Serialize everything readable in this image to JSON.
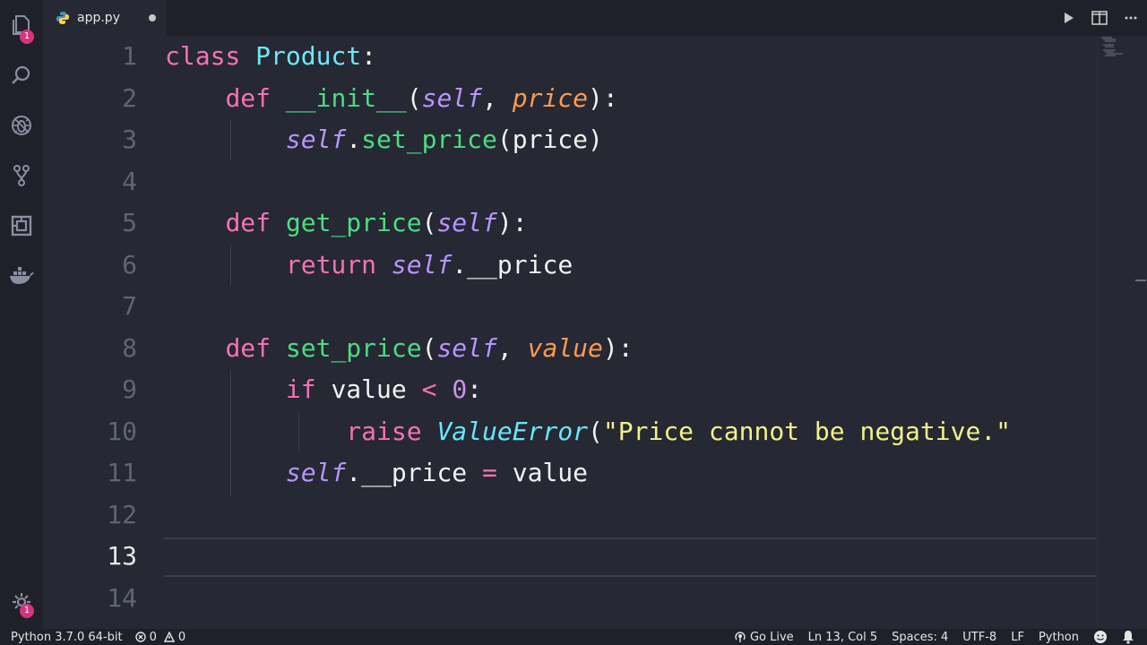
{
  "window": {
    "file_tab": "app.py"
  },
  "activity_bar": {
    "explorer_badge": "1",
    "settings_badge": "1"
  },
  "editor": {
    "line_numbers": [
      "1",
      "2",
      "3",
      "4",
      "5",
      "6",
      "7",
      "8",
      "9",
      "10",
      "11",
      "12",
      "13",
      "14"
    ],
    "lines": [
      [
        {
          "t": "class ",
          "c": "k"
        },
        {
          "t": "Product",
          "c": "c"
        },
        {
          "t": ":",
          "c": ""
        }
      ],
      [
        {
          "t": "    ",
          "c": ""
        },
        {
          "t": "def ",
          "c": "k"
        },
        {
          "t": "__init__",
          "c": "f"
        },
        {
          "t": "(",
          "c": ""
        },
        {
          "t": "self",
          "c": "s"
        },
        {
          "t": ", ",
          "c": ""
        },
        {
          "t": "price",
          "c": "p"
        },
        {
          "t": "):",
          "c": ""
        }
      ],
      [
        {
          "t": "        ",
          "c": ""
        },
        {
          "t": "self",
          "c": "s"
        },
        {
          "t": ".",
          "c": ""
        },
        {
          "t": "set_price",
          "c": "f"
        },
        {
          "t": "(price)",
          "c": ""
        }
      ],
      [],
      [
        {
          "t": "    ",
          "c": ""
        },
        {
          "t": "def ",
          "c": "k"
        },
        {
          "t": "get_price",
          "c": "f"
        },
        {
          "t": "(",
          "c": ""
        },
        {
          "t": "self",
          "c": "s"
        },
        {
          "t": "):",
          "c": ""
        }
      ],
      [
        {
          "t": "        ",
          "c": ""
        },
        {
          "t": "return ",
          "c": "k"
        },
        {
          "t": "self",
          "c": "s"
        },
        {
          "t": ".__price",
          "c": ""
        }
      ],
      [],
      [
        {
          "t": "    ",
          "c": ""
        },
        {
          "t": "def ",
          "c": "k"
        },
        {
          "t": "set_price",
          "c": "f"
        },
        {
          "t": "(",
          "c": ""
        },
        {
          "t": "self",
          "c": "s"
        },
        {
          "t": ", ",
          "c": ""
        },
        {
          "t": "value",
          "c": "p"
        },
        {
          "t": "):",
          "c": ""
        }
      ],
      [
        {
          "t": "        ",
          "c": ""
        },
        {
          "t": "if ",
          "c": "k"
        },
        {
          "t": "value ",
          "c": ""
        },
        {
          "t": "< ",
          "c": "o"
        },
        {
          "t": "0",
          "c": "n"
        },
        {
          "t": ":",
          "c": ""
        }
      ],
      [
        {
          "t": "            ",
          "c": ""
        },
        {
          "t": "raise ",
          "c": "k"
        },
        {
          "t": "ValueError",
          "c": "e"
        },
        {
          "t": "(",
          "c": ""
        },
        {
          "t": "\"Price cannot be negative.\"",
          "c": "str"
        }
      ],
      [
        {
          "t": "        ",
          "c": ""
        },
        {
          "t": "self",
          "c": "s"
        },
        {
          "t": ".__price ",
          "c": ""
        },
        {
          "t": "= ",
          "c": "o"
        },
        {
          "t": "value",
          "c": ""
        }
      ],
      [],
      [],
      []
    ],
    "current_line": 13
  },
  "statusbar": {
    "interpreter": "Python 3.7.0 64-bit",
    "errors": "0",
    "warnings": "0",
    "go_live": "Go Live",
    "cursor": "Ln 13, Col 5",
    "spaces": "Spaces: 4",
    "encoding": "UTF-8",
    "eol": "LF",
    "language": "Python"
  },
  "colors": {
    "background": "#262833",
    "chrome": "#1f2029",
    "keyword": "#f472b6",
    "function": "#4ade80",
    "self": "#b894ff",
    "param": "#fb9b52",
    "string": "#f3f08a",
    "badge": "#d6337f"
  }
}
